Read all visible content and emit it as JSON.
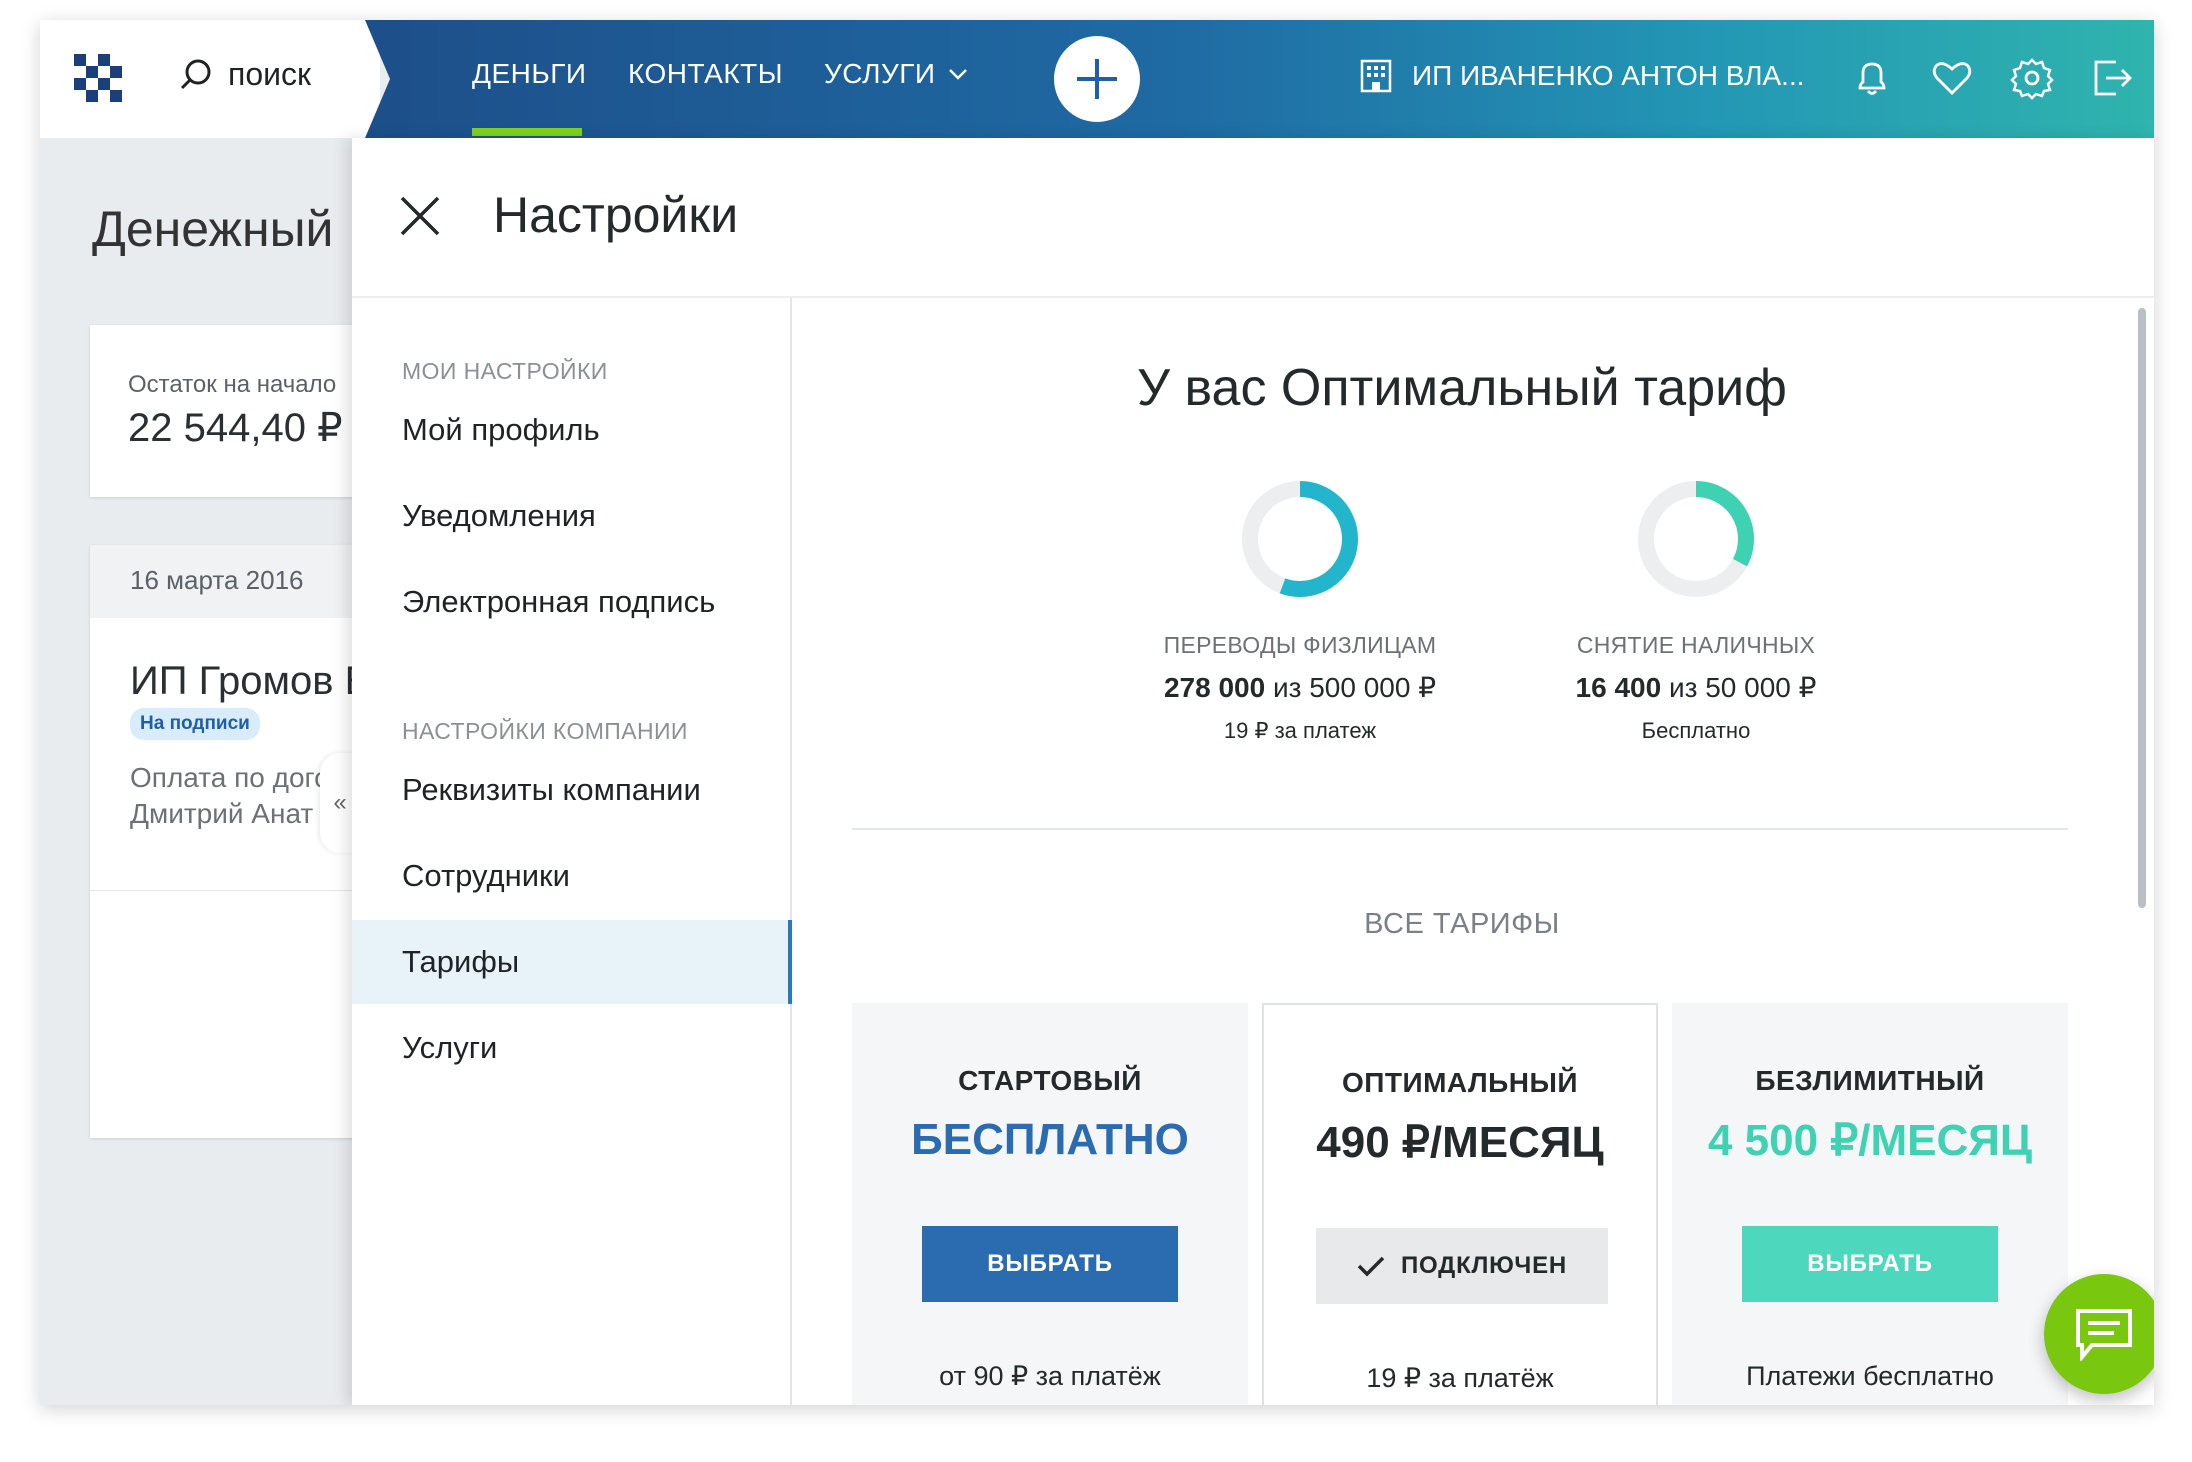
{
  "header": {
    "search_label": "поиск",
    "nav": [
      "ДЕНЬГИ",
      "КОНТАКТЫ",
      "УСЛУГИ"
    ],
    "company": "ИП ИВАНЕНКО АНТОН ВЛА...",
    "accent_color": "#7ed321"
  },
  "background_page": {
    "title": "Денежный",
    "balance_label": "Остаток на начало",
    "balance_value": "22 544,40 ₽",
    "date": "16 марта 2016",
    "payee": "ИП Громов Е",
    "status_badge": "На подписи",
    "desc_line1": "Оплата по дого",
    "desc_line2": "Дмитрий Анат"
  },
  "settings": {
    "title": "Настройки",
    "section_my": "МОИ НАСТРОЙКИ",
    "items_my": [
      "Мой профиль",
      "Уведомления",
      "Электронная подпись"
    ],
    "section_company": "НАСТРОЙКИ КОМПАНИИ",
    "items_company": [
      "Реквизиты компании",
      "Сотрудники",
      "Тарифы",
      "Услуги"
    ],
    "active_item": "Тарифы"
  },
  "plan": {
    "current_title": "У вас Оптимальный тариф",
    "stats": [
      {
        "label": "ПЕРЕВОДЫ ФИЗЛИЦАМ",
        "used": "278 000",
        "of": "из",
        "limit": "500 000",
        "currency": "₽",
        "note": "19 ₽ за платеж",
        "fraction": 0.556,
        "color": "#23b5cc"
      },
      {
        "label": "СНЯТИЕ НАЛИЧНЫХ",
        "used": "16 400",
        "of": "из",
        "limit": "50 000",
        "currency": "₽",
        "note": "Бесплатно",
        "fraction": 0.328,
        "color": "#3ed1b2"
      }
    ],
    "all_tariffs_label": "ВСЕ ТАРИФЫ",
    "tariffs": [
      {
        "name": "СТАРТОВЫЙ",
        "price": "БЕСПЛАТНО",
        "price_color": "#2b6cb0",
        "button": "ВЫБРАТЬ",
        "button_bg": "#2b6cb0",
        "button_color": "#ffffff",
        "footer": "от 90 ₽ за платёж"
      },
      {
        "name": "ОПТИМАЛЬНЫЙ",
        "price": "490 ₽/МЕСЯЦ",
        "price_color": "#24292c",
        "button": "ПОДКЛЮЧЕН",
        "button_bg": "#e8e9ea",
        "button_color": "#24292c",
        "footer": "19 ₽ за платёж"
      },
      {
        "name": "БЕЗЛИМИТНЫЙ",
        "price": "4 500 ₽/МЕСЯЦ",
        "price_color": "#3ed1b2",
        "button": "ВЫБРАТЬ",
        "button_bg": "#4dd8bd",
        "button_color": "#ffffff",
        "footer": "Платежи бесплатно"
      }
    ]
  }
}
